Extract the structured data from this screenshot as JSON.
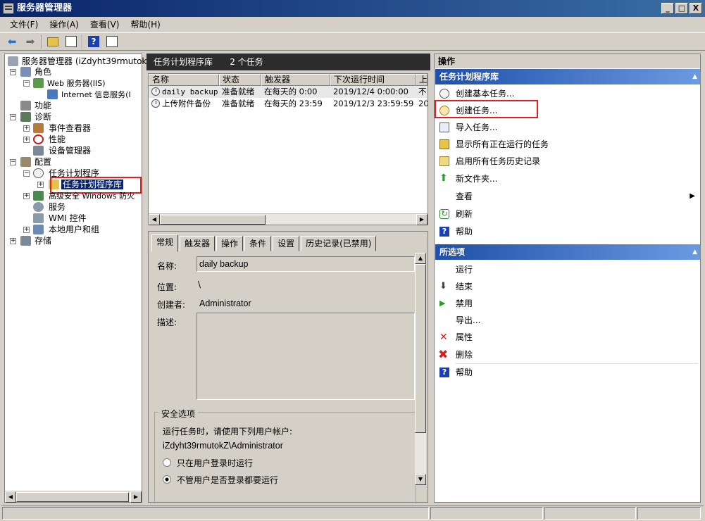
{
  "window": {
    "title": "服务器管理器",
    "min": "_",
    "max": "□",
    "close": "X"
  },
  "menu": [
    "文件(F)",
    "操作(A)",
    "查看(V)",
    "帮助(H)"
  ],
  "tree": {
    "root": "服务器管理器 (iZdyht39rmutok",
    "roles": "角色",
    "web": "Web 服务器(IIS)",
    "iis": "Internet 信息服务(I",
    "features": "功能",
    "diag": "诊断",
    "eventviewer": "事件查看器",
    "perf": "性能",
    "devmgr": "设备管理器",
    "config": "配置",
    "tasksched": "任务计划程序",
    "tasklib": "任务计划程序库",
    "firewall": "高级安全 Windows 防火",
    "services": "服务",
    "wmi": "WMI 控件",
    "localusers": "本地用户和组",
    "storage": "存储"
  },
  "center": {
    "title": "任务计划程序库",
    "count": "2 个任务",
    "columns": [
      "名称",
      "状态",
      "触发器",
      "下次运行时间",
      "上"
    ],
    "rows": [
      {
        "name": "daily backup",
        "status": "准备就绪",
        "trigger": "在每天的 0:00",
        "next": "2019/12/4 0:00:00",
        "last": "不"
      },
      {
        "name": "上传附件备份",
        "status": "准备就绪",
        "trigger": "在每天的 23:59",
        "next": "2019/12/3 23:59:59",
        "last": "20"
      }
    ]
  },
  "detail": {
    "tabs": [
      "常规",
      "触发器",
      "操作",
      "条件",
      "设置",
      "历史记录(已禁用)"
    ],
    "name_label": "名称:",
    "name_value": "daily backup",
    "location_label": "位置:",
    "location_value": "\\",
    "author_label": "创建者:",
    "author_value": "Administrator",
    "desc_label": "描述:",
    "security_group": "安全选项",
    "run_as_label": "运行任务时，请使用下列用户帐户:",
    "run_as_value": "iZdyht39rmutokZ\\Administrator",
    "radio1": "只在用户登录时运行",
    "radio2": "不管用户是否登录都要运行"
  },
  "actions": {
    "header": "操作",
    "section1": "任务计划程序库",
    "items1": [
      "创建基本任务...",
      "创建任务...",
      "导入任务...",
      "显示所有正在运行的任务",
      "启用所有任务历史记录",
      "新文件夹...",
      "查看",
      "刷新",
      "帮助"
    ],
    "section2": "所选项",
    "items2": [
      "运行",
      "结束",
      "禁用",
      "导出...",
      "属性",
      "删除",
      "帮助"
    ]
  }
}
